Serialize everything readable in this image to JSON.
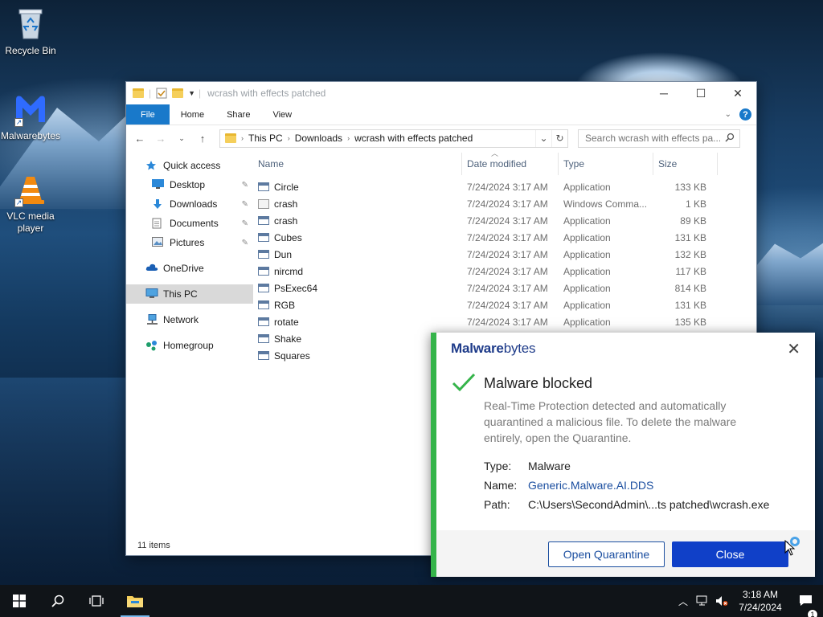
{
  "desktop": {
    "icons": [
      {
        "label": "Recycle Bin"
      },
      {
        "label": "Malwarebytes"
      },
      {
        "label": "VLC media player"
      }
    ]
  },
  "explorer": {
    "title": "wcrash with effects patched",
    "ribbon_tabs": [
      "File",
      "Home",
      "Share",
      "View"
    ],
    "breadcrumb": [
      "This PC",
      "Downloads",
      "wcrash with effects patched"
    ],
    "search_placeholder": "Search wcrash with effects pa...",
    "nav": {
      "quick_access": "Quick access",
      "desktop": "Desktop",
      "downloads": "Downloads",
      "documents": "Documents",
      "pictures": "Pictures",
      "onedrive": "OneDrive",
      "this_pc": "This PC",
      "network": "Network",
      "homegroup": "Homegroup"
    },
    "columns": {
      "name": "Name",
      "date": "Date modified",
      "type": "Type",
      "size": "Size"
    },
    "files": [
      {
        "name": "Circle",
        "date": "7/24/2024 3:17 AM",
        "type": "Application",
        "size": "133 KB"
      },
      {
        "name": "crash",
        "date": "7/24/2024 3:17 AM",
        "type": "Windows Comma...",
        "size": "1 KB"
      },
      {
        "name": "crash",
        "date": "7/24/2024 3:17 AM",
        "type": "Application",
        "size": "89 KB"
      },
      {
        "name": "Cubes",
        "date": "7/24/2024 3:17 AM",
        "type": "Application",
        "size": "131 KB"
      },
      {
        "name": "Dun",
        "date": "7/24/2024 3:17 AM",
        "type": "Application",
        "size": "132 KB"
      },
      {
        "name": "nircmd",
        "date": "7/24/2024 3:17 AM",
        "type": "Application",
        "size": "117 KB"
      },
      {
        "name": "PsExec64",
        "date": "7/24/2024 3:17 AM",
        "type": "Application",
        "size": "814 KB"
      },
      {
        "name": "RGB",
        "date": "7/24/2024 3:17 AM",
        "type": "Application",
        "size": "131 KB"
      },
      {
        "name": "rotate",
        "date": "7/24/2024 3:17 AM",
        "type": "Application",
        "size": "135 KB"
      },
      {
        "name": "Shake",
        "date": "",
        "type": "",
        "size": ""
      },
      {
        "name": "Squares",
        "date": "",
        "type": "",
        "size": ""
      }
    ],
    "status": "11 items"
  },
  "toast": {
    "brand_bold": "Malware",
    "brand_light": "bytes",
    "title": "Malware blocked",
    "description": "Real-Time Protection detected and automatically quarantined a malicious file. To delete the malware entirely, open the Quarantine.",
    "type_label": "Type:",
    "type_value": "Malware",
    "name_label": "Name:",
    "name_value": "Generic.Malware.AI.DDS",
    "path_label": "Path:",
    "path_value": "C:\\Users\\SecondAdmin\\...ts patched\\wcrash.exe",
    "open_quarantine": "Open Quarantine",
    "close": "Close",
    "accent_color": "#35b44a",
    "brand_color": "#1040c8"
  },
  "taskbar": {
    "time": "3:18 AM",
    "date": "7/24/2024",
    "notification_count": "1"
  }
}
